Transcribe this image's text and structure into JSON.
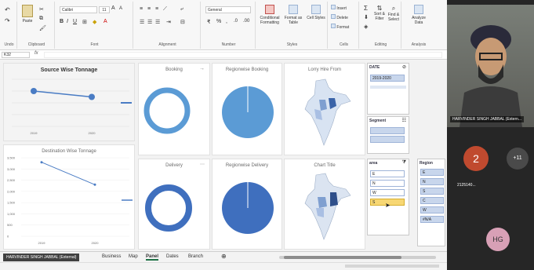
{
  "ribbon": {
    "groups": [
      "Undo",
      "Clipboard",
      "Font",
      "Alignment",
      "Number",
      "Styles",
      "Cells",
      "Editing",
      "Analysis"
    ],
    "font_name": "Calibri",
    "font_size": "11",
    "number_format": "General",
    "paste": "Paste",
    "conditional_formatting": "Conditional Formatting",
    "format_as_table": "Format as Table",
    "cell_styles": "Cell Styles",
    "insert": "Insert",
    "delete": "Delete",
    "format": "Format",
    "sort_filter": "Sort & Filter",
    "find_select": "Find & Select",
    "analyze_data": "Analyze Data"
  },
  "formula_bar": {
    "cell_ref": "K32",
    "fx": "fx"
  },
  "charts": {
    "source": {
      "title": "Source Wise Tonnage",
      "chart_data": {
        "type": "line",
        "categories": [
          "2019",
          "2020"
        ],
        "values": [
          6,
          5
        ],
        "title": "Source Wise Tonnage"
      }
    },
    "destination": {
      "title": "Destination Wise Tonnage",
      "chart_data": {
        "type": "line",
        "categories": [
          "2019",
          "2020"
        ],
        "values": [
          3300,
          2300
        ],
        "title": "Destination Wise Tonnage",
        "ylim": [
          0,
          3500
        ],
        "yticks": [
          "3,500",
          "3,000",
          "2,500",
          "2,000",
          "1,500",
          "1,000",
          "500",
          "0"
        ]
      }
    },
    "booking": {
      "title": "Booking"
    },
    "regionwise_booking": {
      "title": "Regionwise Booking"
    },
    "lorry_hire": {
      "title": "Lorry Hire From"
    },
    "delivery": {
      "title": "Delivery"
    },
    "regionwise_delivery": {
      "title": "Regionwise Delivery"
    },
    "chart_title": {
      "title": "Chart Title"
    }
  },
  "slicers": {
    "date": {
      "title": "DATE",
      "value": "2019-2020"
    },
    "segment": {
      "title": "Segment"
    },
    "area": {
      "title": "area",
      "items": [
        "E",
        "N",
        "W",
        "S"
      ]
    },
    "region": {
      "title": "Region",
      "items": [
        "E",
        "N",
        "S",
        "C",
        "W",
        "#N/A"
      ]
    }
  },
  "sheet_tabs": [
    "Business",
    "Map",
    "Panel",
    "Dates",
    "Branch"
  ],
  "active_tab": "Panel",
  "video": {
    "presenter": "HARVINDER SINGH JABBAL (Extern...",
    "participant_count_label": "2",
    "more_label": "+11",
    "participant_name": "2125140...",
    "participant_initials": "HG",
    "bottom_tag": "HARVINDER SINGH JABBAL (External)"
  }
}
